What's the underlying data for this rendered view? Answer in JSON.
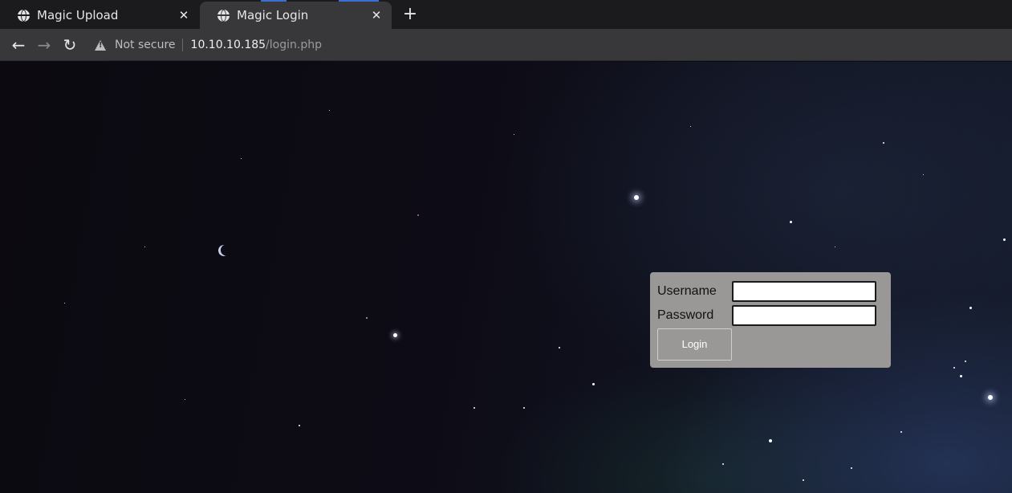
{
  "browser": {
    "tabs": [
      {
        "title": "Magic Upload",
        "active": false
      },
      {
        "title": "Magic Login",
        "active": true
      }
    ],
    "close_glyph": "✕",
    "new_tab_glyph": "+",
    "nav": {
      "back": "←",
      "forward": "→",
      "reload": "↻"
    },
    "security_label": "Not secure",
    "url_host": "10.10.10.185",
    "url_path": "/login.php"
  },
  "login_form": {
    "username_label": "Username",
    "username_value": "",
    "password_label": "Password",
    "password_value": "",
    "submit_label": "Login"
  },
  "icons": {
    "tab_icon": "globe-icon",
    "security_icon": "warning-triangle-icon",
    "background": "starfield"
  },
  "colors": {
    "tab_active_bg": "#38383b",
    "tab_inactive_bg": "#1b1b1d",
    "form_bg": "#9a9896",
    "page_bg": "#0d0c16"
  }
}
